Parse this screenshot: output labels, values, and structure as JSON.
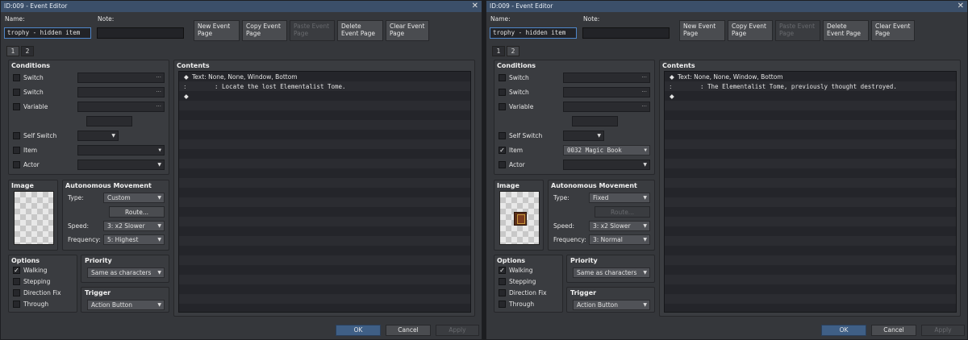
{
  "windows": [
    {
      "title": "ID:009 - Event Editor",
      "name_label": "Name:",
      "name_value": "trophy - hidden item",
      "note_label": "Note:",
      "note_value": "",
      "page_buttons": {
        "new": "New Event Page",
        "copy": "Copy Event Page",
        "paste": "Paste Event Page",
        "delete": "Delete Event Page",
        "clear": "Clear Event Page"
      },
      "tabs": [
        "1",
        "2"
      ],
      "active_tab": 0,
      "conditions": {
        "title": "Conditions",
        "switch1": "Switch",
        "switch2": "Switch",
        "variable": "Variable",
        "self_switch": "Self Switch",
        "item": "Item",
        "item_value": "",
        "item_checked": false,
        "actor": "Actor"
      },
      "image": {
        "title": "Image",
        "has_sprite": false
      },
      "movement": {
        "title": "Autonomous Movement",
        "type_label": "Type:",
        "type_value": "Custom",
        "route": "Route...",
        "route_disabled": false,
        "speed_label": "Speed:",
        "speed_value": "3: x2 Slower",
        "frequency_label": "Frequency:",
        "frequency_value": "5: Highest"
      },
      "options": {
        "title": "Options",
        "walking": "Walking",
        "stepping": "Stepping",
        "direction_fix": "Direction Fix",
        "through": "Through"
      },
      "priority": {
        "title": "Priority",
        "value": "Same as characters"
      },
      "trigger": {
        "title": "Trigger",
        "value": "Action Button"
      },
      "contents": {
        "title": "Contents",
        "text_label": "Text",
        "text_params": ": None, None, Window, Bottom",
        "cont_mark": ":",
        "message": ": Locate the lost Elementalist Tome.",
        "end_mark": "◆"
      },
      "footer": {
        "ok": "OK",
        "cancel": "Cancel",
        "apply": "Apply"
      }
    },
    {
      "title": "ID:009 - Event Editor",
      "name_label": "Name:",
      "name_value": "trophy - hidden item",
      "note_label": "Note:",
      "note_value": "",
      "page_buttons": {
        "new": "New Event Page",
        "copy": "Copy Event Page",
        "paste": "Paste Event Page",
        "delete": "Delete Event Page",
        "clear": "Clear Event Page"
      },
      "tabs": [
        "1",
        "2"
      ],
      "active_tab": 1,
      "conditions": {
        "title": "Conditions",
        "switch1": "Switch",
        "switch2": "Switch",
        "variable": "Variable",
        "self_switch": "Self Switch",
        "item": "Item",
        "item_value": "0032 Magic Book",
        "item_checked": true,
        "actor": "Actor"
      },
      "image": {
        "title": "Image",
        "has_sprite": true
      },
      "movement": {
        "title": "Autonomous Movement",
        "type_label": "Type:",
        "type_value": "Fixed",
        "route": "Route...",
        "route_disabled": true,
        "speed_label": "Speed:",
        "speed_value": "3: x2 Slower",
        "frequency_label": "Frequency:",
        "frequency_value": "3: Normal"
      },
      "options": {
        "title": "Options",
        "walking": "Walking",
        "stepping": "Stepping",
        "direction_fix": "Direction Fix",
        "through": "Through"
      },
      "priority": {
        "title": "Priority",
        "value": "Same as characters"
      },
      "trigger": {
        "title": "Trigger",
        "value": "Action Button"
      },
      "contents": {
        "title": "Contents",
        "text_label": "Text",
        "text_params": ": None, None, Window, Bottom",
        "cont_mark": ":",
        "message": ": The Elementalist Tome, previously thought destroyed.",
        "end_mark": "◆"
      },
      "footer": {
        "ok": "OK",
        "cancel": "Cancel",
        "apply": "Apply"
      }
    }
  ]
}
